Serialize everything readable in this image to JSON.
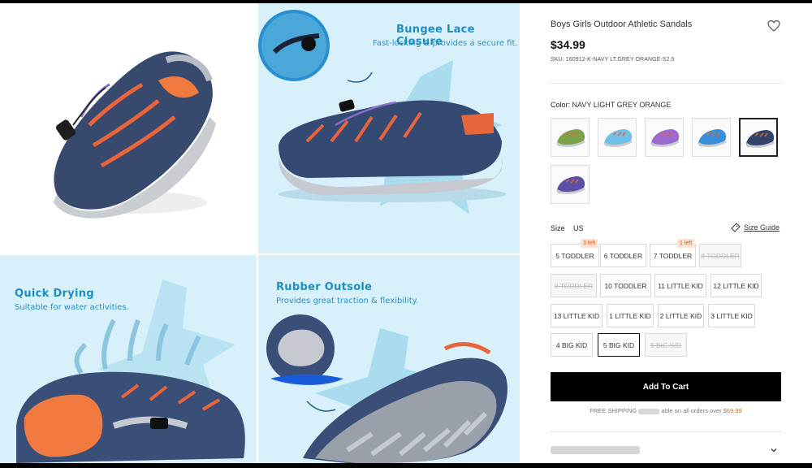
{
  "gallery": {
    "bungee": {
      "title": "Bungee Lace Closure",
      "subtitle": "Fast-locking & provides a secure fit."
    },
    "drying": {
      "title": "Quick Drying",
      "subtitle": "Suitable for water activities."
    },
    "outsole": {
      "title": "Rubber Outsole",
      "subtitle": "Provides great traction & flexibility."
    }
  },
  "product": {
    "title": "Boys Girls Outdoor Athletic Sandals",
    "price": "$34.99",
    "sku": "SKU: 160912-K-NAVY LT.GREY ORANGE-S2.5",
    "color_label": "Color:",
    "color_value": "NAVY LIGHT GREY ORANGE",
    "swatches": [
      {
        "name": "green",
        "color": "#7aa34a",
        "selected": false
      },
      {
        "name": "light-blue",
        "color": "#6fbfe6",
        "selected": false
      },
      {
        "name": "purple",
        "color": "#9a6ad0",
        "selected": false
      },
      {
        "name": "blue-green",
        "color": "#3a8fd6",
        "selected": false
      },
      {
        "name": "navy-grey-orange",
        "color": "#2f4468",
        "selected": true
      },
      {
        "name": "navy-purple",
        "color": "#5b4fa6",
        "selected": false
      }
    ],
    "size_label": "Size",
    "size_unit": "US",
    "size_guide": "Size Guide",
    "sizes": [
      {
        "label": "5 TODDLER",
        "available": true,
        "badge": "3 left"
      },
      {
        "label": "6 TODDLER",
        "available": true,
        "badge": ""
      },
      {
        "label": "7 TODDLER",
        "available": true,
        "badge": "1 left"
      },
      {
        "label": "8 TODDLER",
        "available": false,
        "badge": ""
      },
      {
        "label": "9 TODDLER",
        "available": false,
        "badge": ""
      },
      {
        "label": "10 TODDLER",
        "available": true,
        "badge": ""
      },
      {
        "label": "11 LITTLE KID",
        "available": true,
        "badge": ""
      },
      {
        "label": "12 LITTLE KID",
        "available": true,
        "badge": ""
      },
      {
        "label": "13 LITTLE KID",
        "available": true,
        "badge": ""
      },
      {
        "label": "1 LITTLE KID",
        "available": true,
        "badge": ""
      },
      {
        "label": "2 LITTLE KID",
        "available": true,
        "badge": ""
      },
      {
        "label": "3 LITTLE KID",
        "available": true,
        "badge": ""
      },
      {
        "label": "4 BIG KID",
        "available": true,
        "badge": ""
      },
      {
        "label": "5 BIG KID",
        "available": true,
        "badge": "",
        "selected": true
      },
      {
        "label": "6 BIG KID",
        "available": false,
        "badge": ""
      }
    ],
    "add_to_cart": "Add To Cart",
    "shipping_prefix": "FREE SHIPPING",
    "shipping_middle": "able on all orders over",
    "shipping_amount": "$69.99"
  }
}
